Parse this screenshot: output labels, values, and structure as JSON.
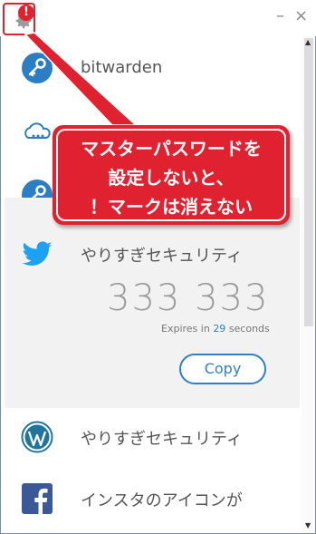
{
  "window": {
    "minimize_glyph": "–",
    "close_glyph": "×",
    "warning_glyph": "!"
  },
  "items": [
    {
      "name": "bitwarden",
      "icon": "key-icon"
    },
    {
      "name": "",
      "icon": "cloud-icon"
    },
    {
      "name": "",
      "icon": "key-icon"
    },
    {
      "name": "やりすぎセキュリティ",
      "icon": "twitter-icon",
      "selected": true
    },
    {
      "name": "やりすぎセキュリティ",
      "icon": "wordpress-icon"
    },
    {
      "name": "インスタのアイコンが",
      "icon": "facebook-icon"
    }
  ],
  "otp": {
    "code": "333 333",
    "expires_prefix": "Expires in",
    "seconds": "29",
    "expires_suffix": "seconds",
    "copy_label": "Copy"
  },
  "annotation": {
    "line1": "マスターパスワードを",
    "line2": "設定しないと、",
    "line3": "！マークは消えない",
    "color": "#e0212f"
  },
  "colors": {
    "accent": "#2f7fc5",
    "key_icon": "#2b7ec4",
    "twitter": "#1da1f2",
    "wordpress": "#21759b",
    "facebook": "#3b5998"
  }
}
